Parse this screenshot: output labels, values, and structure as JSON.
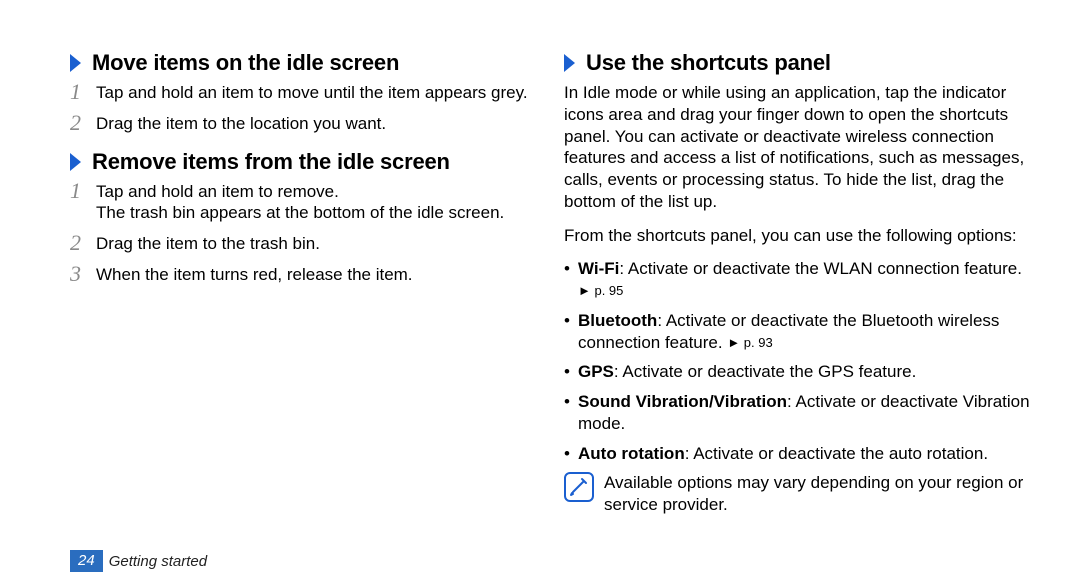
{
  "leftColumn": {
    "section1": {
      "heading": "Move items on the idle screen",
      "steps": [
        {
          "num": "1",
          "text": "Tap and hold an item to move until the item appears grey."
        },
        {
          "num": "2",
          "text": "Drag the item to the location you want."
        }
      ]
    },
    "section2": {
      "heading": "Remove items from the idle screen",
      "steps": [
        {
          "num": "1",
          "text": "Tap and hold an item to remove.",
          "text2": "The trash bin appears at the bottom of the idle screen."
        },
        {
          "num": "2",
          "text": "Drag the item to the trash bin."
        },
        {
          "num": "3",
          "text": "When the item turns red, release the item."
        }
      ]
    }
  },
  "rightColumn": {
    "section": {
      "heading": "Use the shortcuts panel",
      "intro": "In Idle mode or while using an application, tap the indicator icons area and drag your finger down to open the shortcuts panel. You can activate or deactivate wireless connection features and access a list of notifications, such as messages, calls, events or processing status. To hide the list, drag the bottom of the list up.",
      "lead": "From the shortcuts panel, you can use the following options:",
      "bullets": [
        {
          "bold": "Wi-Fi",
          "rest": ": Activate or deactivate the WLAN connection feature. ",
          "ref": "► p. 95"
        },
        {
          "bold": "Bluetooth",
          "rest": ": Activate or deactivate the Bluetooth wireless connection feature. ",
          "ref": "► p. 93"
        },
        {
          "bold": "GPS",
          "rest": ": Activate or deactivate the GPS feature.",
          "ref": ""
        },
        {
          "bold": "Sound Vibration/Vibration",
          "rest": ": Activate or deactivate Vibration mode.",
          "ref": ""
        },
        {
          "bold": "Auto rotation",
          "rest": ": Activate or deactivate the auto rotation.",
          "ref": ""
        }
      ],
      "note": "Available options may vary depending on your region or service provider."
    }
  },
  "footer": {
    "page": "24",
    "chapter": "Getting started"
  }
}
